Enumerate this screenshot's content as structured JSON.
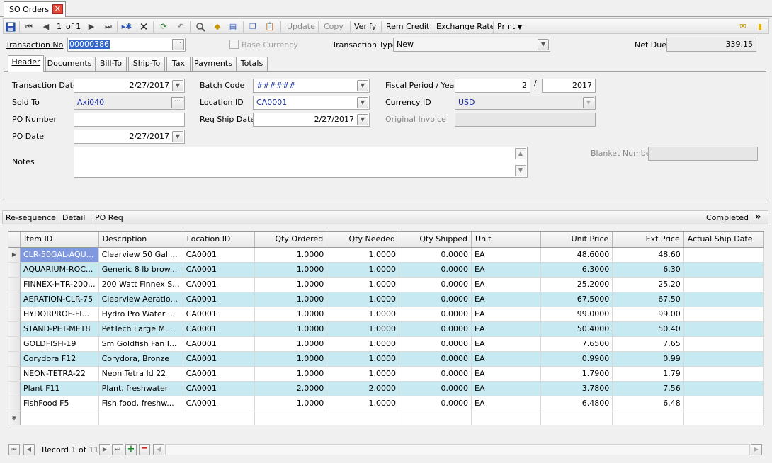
{
  "window": {
    "tab_title": "SO Orders"
  },
  "toolbar": {
    "page_current": "1",
    "page_of": "of 1",
    "update": "Update",
    "copy": "Copy",
    "verify": "Verify",
    "rem_credit": "Rem Credit",
    "exchange_rate": "Exchange Rate",
    "print": "Print"
  },
  "header": {
    "transaction_no_label": "Transaction No",
    "transaction_no": "00000386",
    "base_currency_label": "Base Currency",
    "transaction_type_label": "Transaction Type",
    "transaction_type": "New",
    "net_due_label": "Net Due",
    "net_due": "339.15"
  },
  "tabs": [
    "Header",
    "Documents",
    "Bill-To",
    "Ship-To",
    "Tax",
    "Payments",
    "Totals"
  ],
  "form": {
    "transaction_date_label": "Transaction Date",
    "transaction_date": "2/27/2017",
    "sold_to_label": "Sold To",
    "sold_to": "Axi040",
    "po_number_label": "PO Number",
    "po_number": "",
    "po_date_label": "PO Date",
    "po_date": "2/27/2017",
    "notes_label": "Notes",
    "notes": "",
    "batch_code_label": "Batch Code",
    "batch_code": "######",
    "location_id_label": "Location ID",
    "location_id": "CA0001",
    "req_ship_date_label": "Req Ship Date",
    "req_ship_date": "2/27/2017",
    "fiscal_period_label": "Fiscal Period / Year",
    "fiscal_period": "2",
    "fiscal_year": "2017",
    "currency_id_label": "Currency ID",
    "currency_id": "USD",
    "original_invoice_label": "Original Invoice",
    "original_invoice": "",
    "blanket_number_label": "Blanket Number",
    "blanket_number": ""
  },
  "actions": {
    "resequence": "Re-sequence",
    "detail": "Detail",
    "po_req": "PO Req",
    "completed": "Completed"
  },
  "grid": {
    "columns": [
      "Item ID",
      "Description",
      "Location ID",
      "Qty Ordered",
      "Qty Needed",
      "Qty Shipped",
      "Unit",
      "Unit Price",
      "Ext Price",
      "Actual Ship Date"
    ],
    "rows": [
      [
        "CLR-50GAL-AQU...",
        "Clearview 50 Gall...",
        "CA0001",
        "1.0000",
        "1.0000",
        "0.0000",
        "EA",
        "48.6000",
        "48.60",
        ""
      ],
      [
        "AQUARIUM-ROC...",
        "Generic 8 lb brow...",
        "CA0001",
        "1.0000",
        "1.0000",
        "0.0000",
        "EA",
        "6.3000",
        "6.30",
        ""
      ],
      [
        "FINNEX-HTR-200...",
        "200 Watt Finnex S...",
        "CA0001",
        "1.0000",
        "1.0000",
        "0.0000",
        "EA",
        "25.2000",
        "25.20",
        ""
      ],
      [
        "AERATION-CLR-75",
        "Clearview Aeratio...",
        "CA0001",
        "1.0000",
        "1.0000",
        "0.0000",
        "EA",
        "67.5000",
        "67.50",
        ""
      ],
      [
        "HYDORPROF-FI...",
        "Hydro Pro Water ...",
        "CA0001",
        "1.0000",
        "1.0000",
        "0.0000",
        "EA",
        "99.0000",
        "99.00",
        ""
      ],
      [
        "STAND-PET-MET8",
        "PetTech Large M...",
        "CA0001",
        "1.0000",
        "1.0000",
        "0.0000",
        "EA",
        "50.4000",
        "50.40",
        ""
      ],
      [
        "GOLDFISH-19",
        "Sm Goldfish Fan I...",
        "CA0001",
        "1.0000",
        "1.0000",
        "0.0000",
        "EA",
        "7.6500",
        "7.65",
        ""
      ],
      [
        "Corydora F12",
        "Corydora, Bronze",
        "CA0001",
        "1.0000",
        "1.0000",
        "0.0000",
        "EA",
        "0.9900",
        "0.99",
        ""
      ],
      [
        "NEON-TETRA-22",
        "Neon Tetra Id 22",
        "CA0001",
        "1.0000",
        "1.0000",
        "0.0000",
        "EA",
        "1.7900",
        "1.79",
        ""
      ],
      [
        "Plant F11",
        "Plant, freshwater",
        "CA0001",
        "2.0000",
        "2.0000",
        "0.0000",
        "EA",
        "3.7800",
        "7.56",
        ""
      ],
      [
        "FishFood F5",
        "Fish food, freshw...",
        "CA0001",
        "1.0000",
        "1.0000",
        "0.0000",
        "EA",
        "6.4800",
        "6.48",
        ""
      ]
    ]
  },
  "navigator": {
    "record_text": "Record 1 of 11"
  }
}
